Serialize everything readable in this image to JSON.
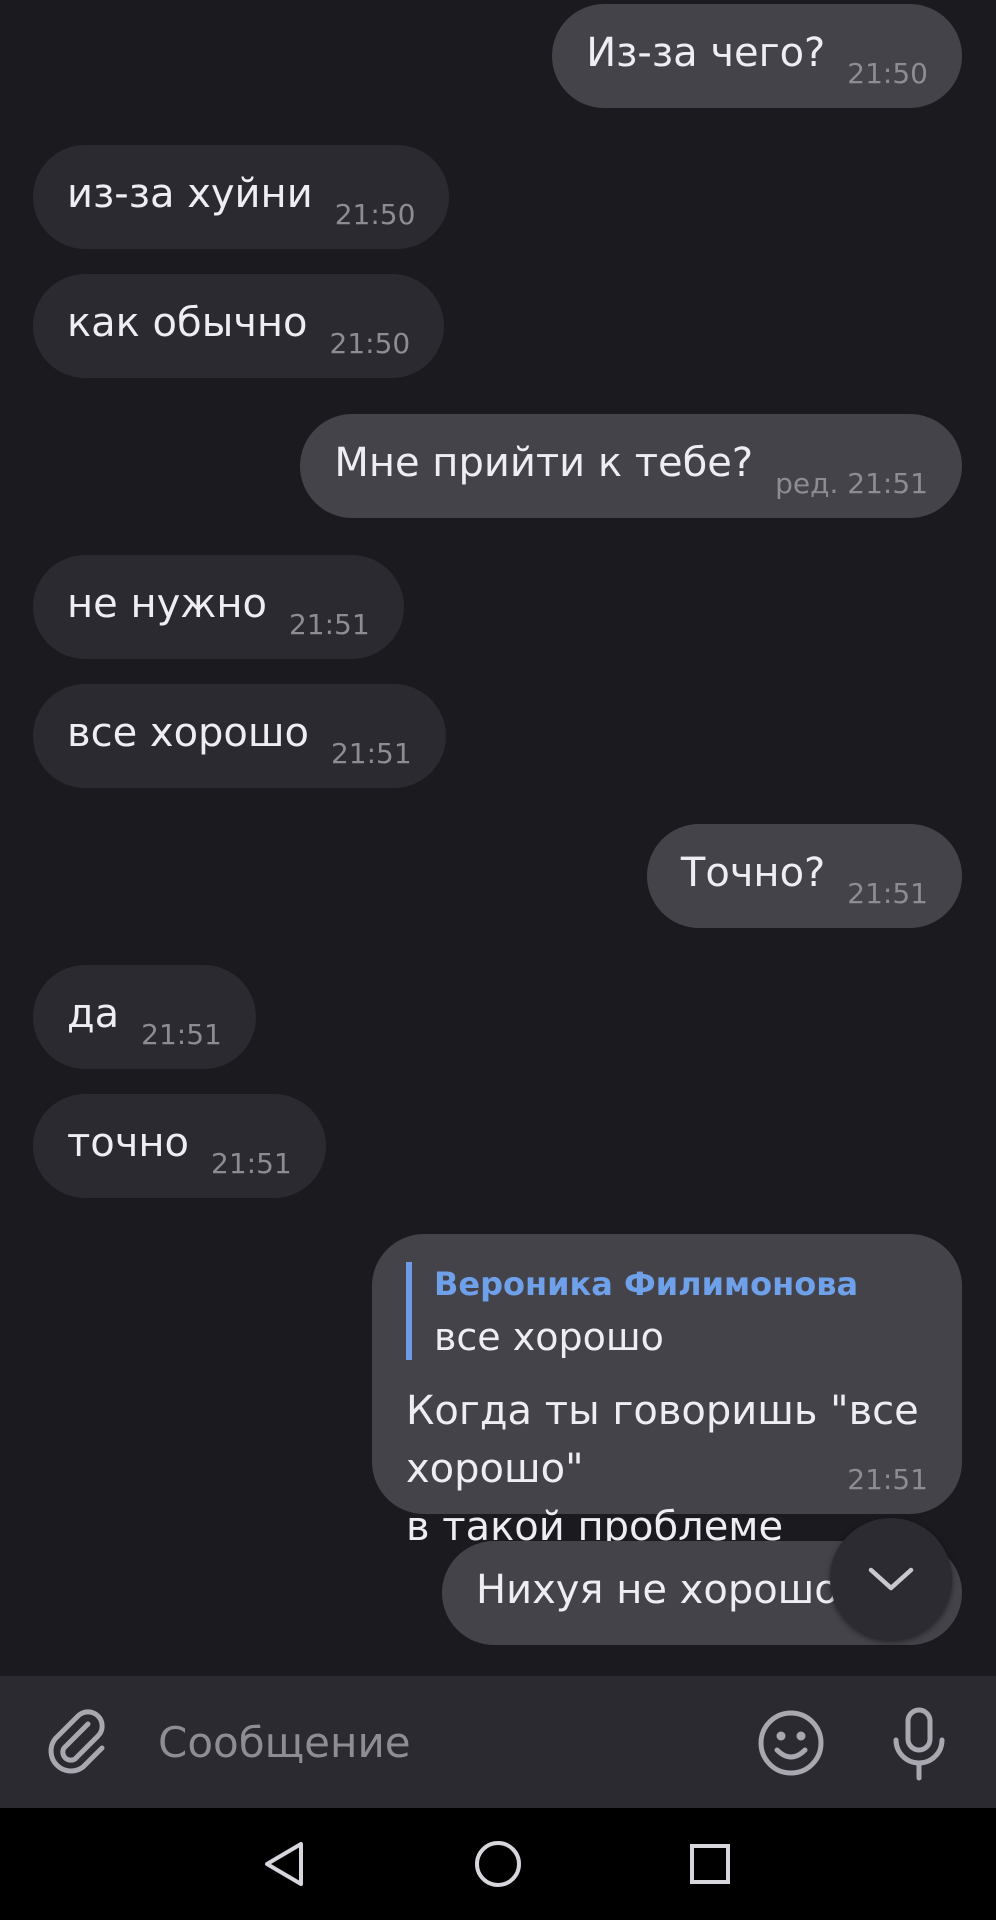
{
  "messages": [
    {
      "direction": "out",
      "text": "Из-за чего?",
      "time": "21:50"
    },
    {
      "direction": "in",
      "text": "из-за хуйни",
      "time": "21:50"
    },
    {
      "direction": "in",
      "text": "как обычно",
      "time": "21:50"
    },
    {
      "direction": "out",
      "text": "Мне прийти к тебе?",
      "time": "ред. 21:51"
    },
    {
      "direction": "in",
      "text": "не нужно",
      "time": "21:51"
    },
    {
      "direction": "in",
      "text": "все хорошо",
      "time": "21:51"
    },
    {
      "direction": "out",
      "text": "Точно?",
      "time": "21:51"
    },
    {
      "direction": "in",
      "text": "да",
      "time": "21:51"
    },
    {
      "direction": "in",
      "text": "точно",
      "time": "21:51"
    }
  ],
  "reply_message": {
    "quote_author": "Вероника Филимонова",
    "quote_text": "все хорошо",
    "text_line1": "Когда ты говоришь \"все хорошо\"",
    "text_line2": "в такой проблеме",
    "time": "21:51"
  },
  "last_message": {
    "direction": "out",
    "text": "Нихуя не хорошо"
  },
  "scroll_down_button": {
    "icon": "chevron-down-icon"
  },
  "composer": {
    "placeholder": "Сообщение",
    "attach_icon": "paperclip-icon",
    "emoji_icon": "smiley-icon",
    "mic_icon": "microphone-icon"
  },
  "nav": {
    "back_icon": "triangle-back-icon",
    "home_icon": "circle-home-icon",
    "recent_icon": "square-recents-icon"
  },
  "colors": {
    "background": "#1b1a1f",
    "incoming_bubble": "#2b2a30",
    "outgoing_bubble": "#44434a",
    "quote_accent": "#6fa0ea",
    "timestamp": "#8d8c94"
  }
}
